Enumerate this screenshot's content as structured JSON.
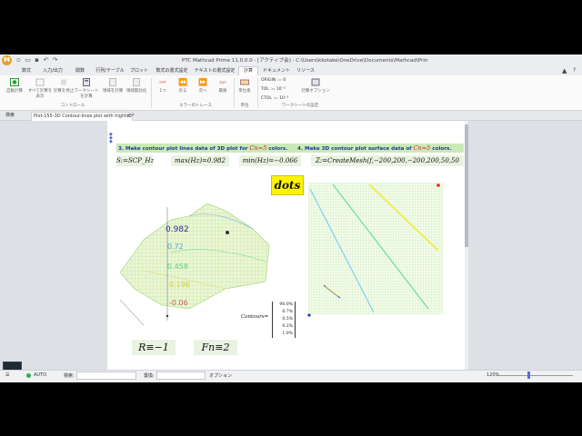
{
  "window": {
    "title": "PTC Mathcad Prime 11.0.0.0 - [アクティブ会]  - C:\\Users\\kkotake\\OneDrive\\Documents\\Mathcad\\Prime"
  },
  "quick_access": {
    "app_initial": "M"
  },
  "ribbon_tabs": [
    {
      "label": "数式"
    },
    {
      "label": "入力/出力"
    },
    {
      "label": "関数"
    },
    {
      "label": "行列/テーブル"
    },
    {
      "label": "プロット"
    },
    {
      "label": "数式の書式設定"
    },
    {
      "label": "テキストの書式設定"
    },
    {
      "label": "計算"
    },
    {
      "label": "ドキュメント"
    },
    {
      "label": "リソース"
    }
  ],
  "ribbon": {
    "buttons": {
      "auto_calc": "自動計算",
      "calc_all": "すべて計算を表示",
      "stop_calc": "計算を停止",
      "worksheet_calc": "ワークシートを計算",
      "calc_region": "領域を計算",
      "disable_region": "領域無効化",
      "step_into": "1つ",
      "step_back": "戻る",
      "step_next": "次へ",
      "step_end": "最後",
      "unit_system": "単位系",
      "calc_options": "計算オプション"
    },
    "groups": {
      "controls": "コントロール",
      "error_trace": "エラーのトレース",
      "units": "単位",
      "worksheet_settings": "ワークシートの設定"
    },
    "options": {
      "origin": "ORIGIN := 0",
      "tol": "TOL := 10⁻³",
      "ctol": "CTOL := 10⁻³"
    }
  },
  "doc_tabs": [
    {
      "label": "検索"
    },
    {
      "label": "Plot-155-3D Contour-lines plot with hights3*"
    }
  ],
  "worksheet": {
    "section3_title": "3. Make contour plot lines data of 3D plot for",
    "section3_var": "Cn=5",
    "section3_suffix": "colors.",
    "section4_title": "4. Make 3D contour plot surface data of",
    "section4_var": "Cn=5",
    "section4_suffix": "colors.",
    "expr_s": "S:=SCP_Hz",
    "expr_max": "max(Hz)=0.982",
    "expr_min": "min(Hz)=−0.066",
    "expr_mesh": "Z:=CreateMesh(f,−200,200,−200,200,50,50",
    "dots_label": "dots",
    "plot_labels": {
      "v1": "0.982",
      "v2": "0.72",
      "v3": "0.458",
      "v4": "0.196",
      "v5": "-0.06"
    },
    "contours_label": "Contours=",
    "contours_values": [
      "90.0%",
      "0.7%",
      "0.5%",
      "0.2%",
      "1.0%"
    ],
    "r_expr": "R≡−1",
    "fn_expr": "Fn≡2"
  },
  "status": {
    "auto_label": "AUTO",
    "search_label": "検索:",
    "replace_label": "置換:",
    "options_label": "オプション",
    "zoom": "120%"
  },
  "colors": {
    "title_green": "#cbe9b8",
    "title_text": "#1a3a8f",
    "var_red": "#d01c1c",
    "dots_yellow": "#fff400"
  }
}
